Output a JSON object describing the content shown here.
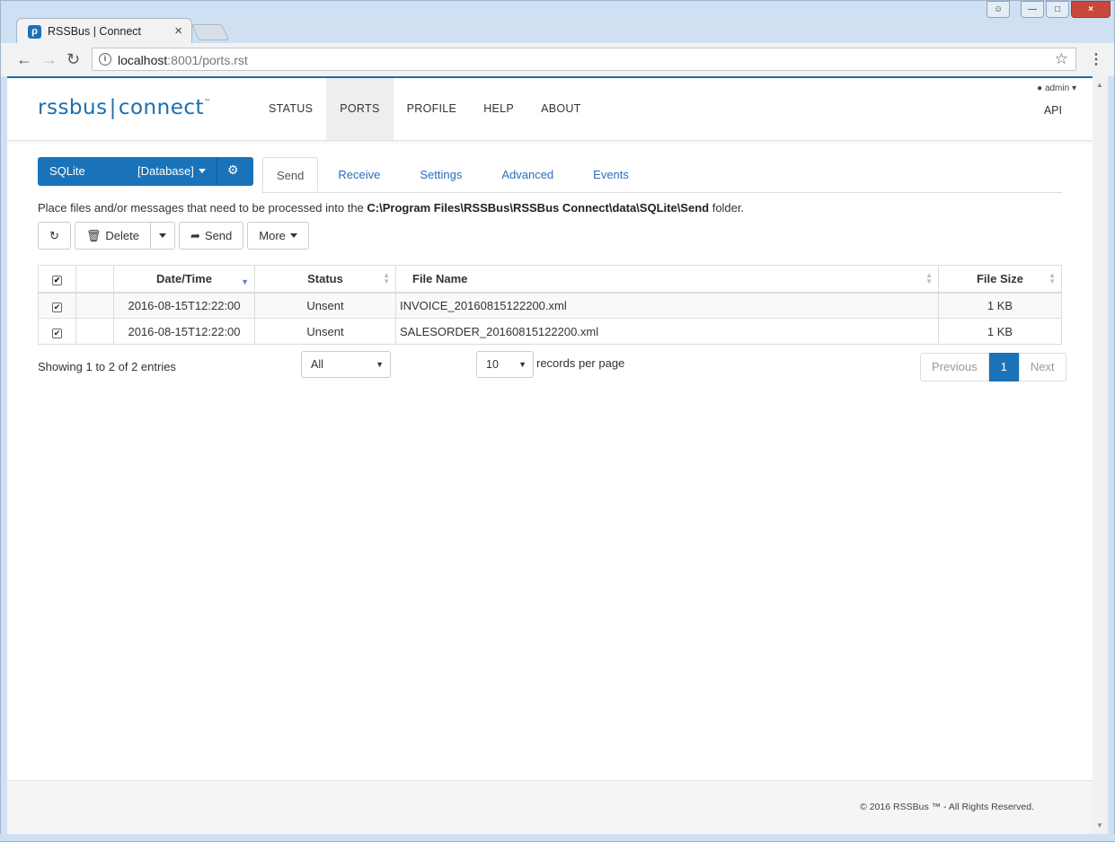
{
  "browser": {
    "tab_title": "RSSBus | Connect",
    "url_host": "localhost",
    "url_rest": ":8001/ports.rst",
    "close_glyph": "×"
  },
  "header": {
    "logo_left": "rssbus",
    "logo_right": "connect",
    "logo_tm": "™",
    "nav": [
      "STATUS",
      "PORTS",
      "PROFILE",
      "HELP",
      "ABOUT"
    ],
    "active_nav": "PORTS",
    "user": "admin",
    "api": "API"
  },
  "port": {
    "name": "SQLite",
    "type": "[Database]"
  },
  "tabs": [
    "Send",
    "Receive",
    "Settings",
    "Advanced",
    "Events"
  ],
  "active_tab": "Send",
  "description": {
    "prefix": "Place files and/or messages that need to be processed into the ",
    "path": "C:\\Program Files\\RSSBus\\RSSBus Connect\\data\\SQLite\\Send",
    "suffix": " folder."
  },
  "toolbar": {
    "delete_label": "Delete",
    "send_label": "Send",
    "more_label": "More"
  },
  "table": {
    "columns": [
      "Date/Time",
      "Status",
      "File Name",
      "File Size"
    ],
    "rows": [
      {
        "datetime": "2016-08-15T12:22:00",
        "status": "Unsent",
        "filename": "INVOICE_20160815122200.xml",
        "size": "1 KB"
      },
      {
        "datetime": "2016-08-15T12:22:00",
        "status": "Unsent",
        "filename": "SALESORDER_20160815122200.xml",
        "size": "1 KB"
      }
    ]
  },
  "footer_controls": {
    "info": "Showing 1 to 2 of 2 entries",
    "filter_value": "All",
    "page_size": "10",
    "records_label": "records per page",
    "prev": "Previous",
    "page": "1",
    "next": "Next"
  },
  "footer": {
    "copyright": "© 2016 RSSBus ™ - All Rights Reserved."
  },
  "colors": {
    "brand": "#1a73b8",
    "link": "#2a6ebb"
  }
}
